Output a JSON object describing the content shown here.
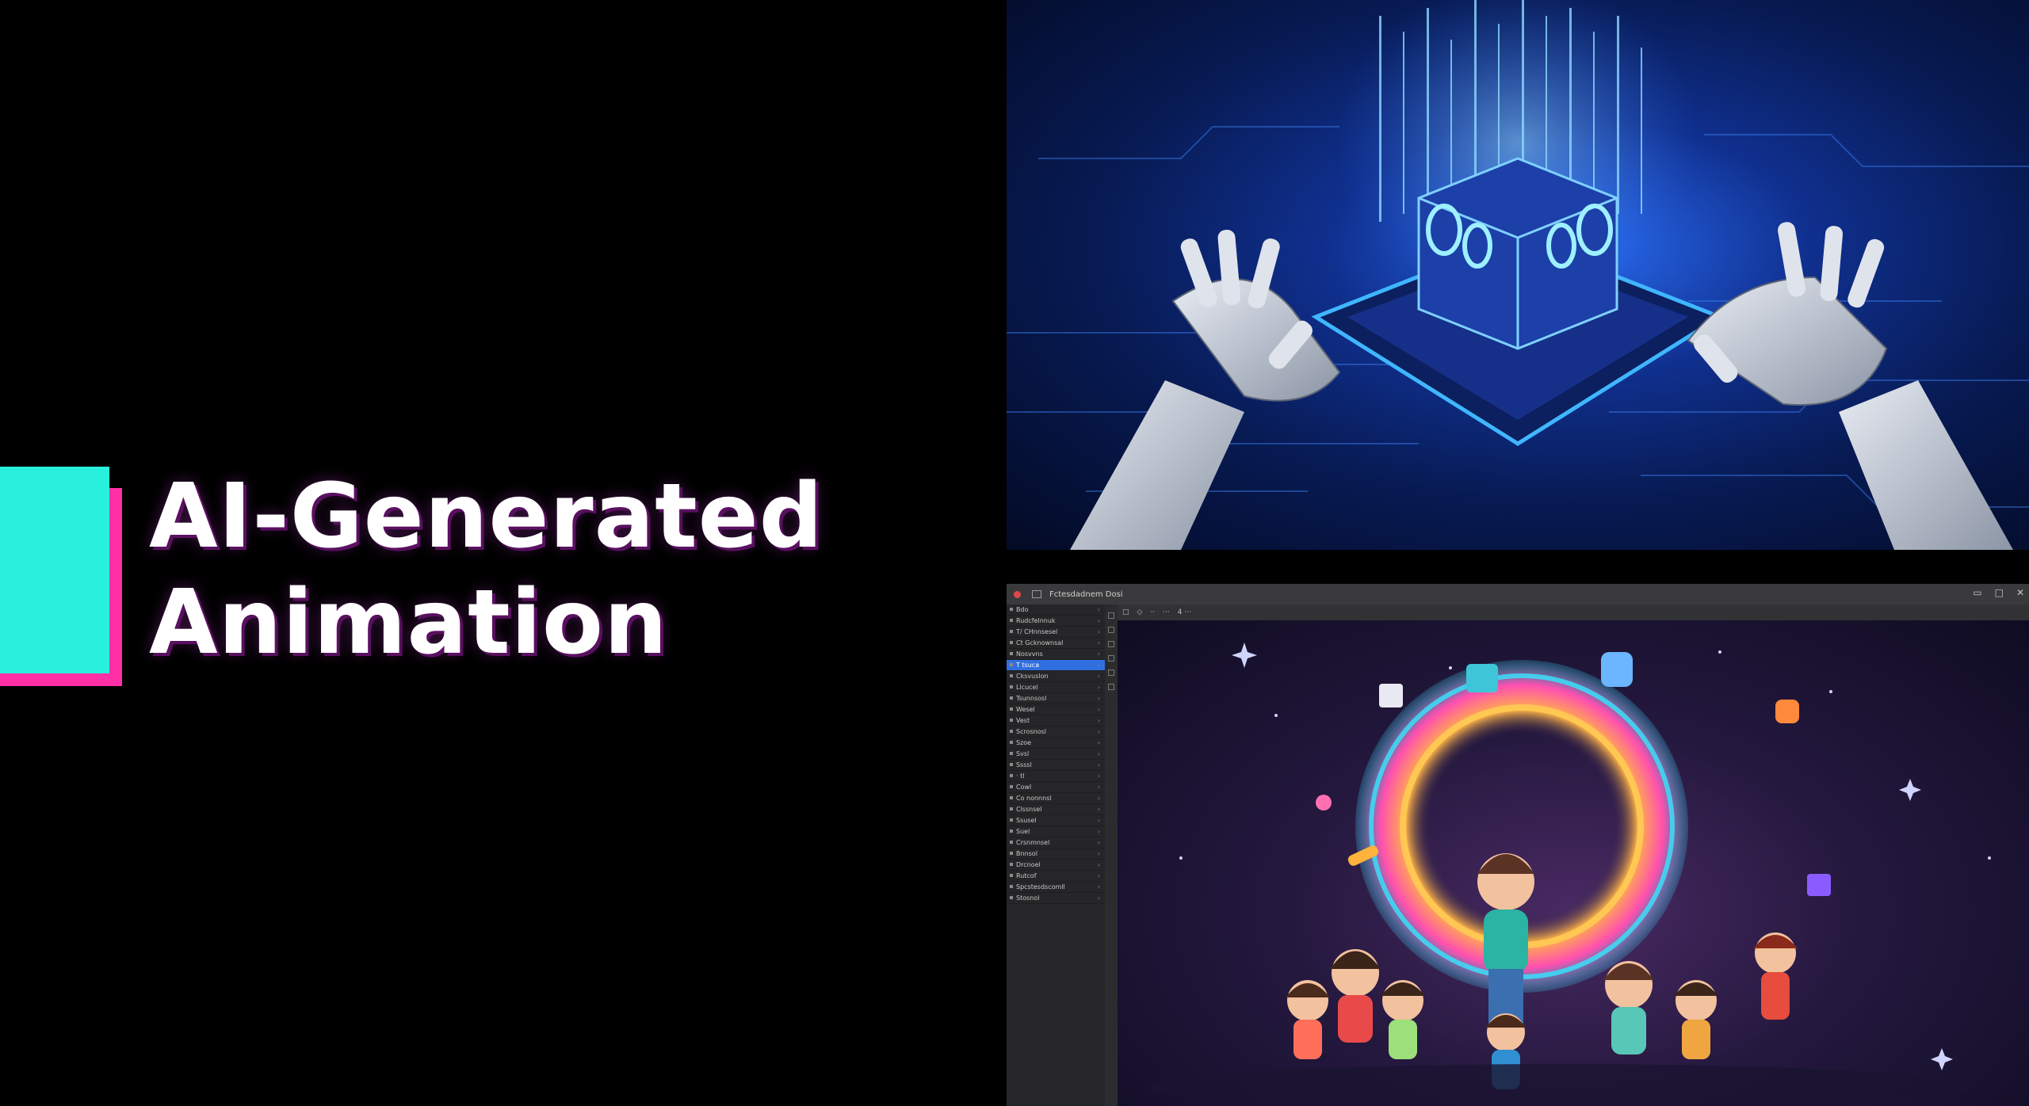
{
  "title": {
    "line1": "AI-Generated",
    "line2": "Animation"
  },
  "colors": {
    "accent_cyan": "#29f0dc",
    "accent_magenta": "#ff2fa6",
    "circuit_blue": "#2a6df5",
    "canvas_purple": "#24183e"
  },
  "top_image": {
    "icon": "robot-hands-chip-illustration"
  },
  "app_window": {
    "title": "Fctesdadnem Dosi",
    "toolbar_items": [
      "□",
      "◇",
      "··",
      "···",
      "4 ···"
    ],
    "sidebar_rows": [
      "Bdo",
      "Rudcfelnnuk",
      "T/ CHnnsesel",
      "Ct Gcknownsal",
      "Nosvvns",
      "T tsuca",
      "Cksvuslon",
      "Llcucel",
      "Tsunnsosl",
      "Wesel",
      "Vest",
      "Scrosnosl",
      "Szoe",
      "Svsl",
      "Ssssl",
      "· tl",
      "Cowl",
      "Co nonnnsl",
      "Clssnsel",
      "Ssusel",
      "Suel",
      "Crsnmnsel",
      "Bnnsol",
      "Drcnoel",
      "Rutcof",
      "Spcstesdscomll",
      "Stosnol"
    ],
    "active_row_index": 5,
    "canvas_icon": "cartoon-characters-portal-scene"
  }
}
